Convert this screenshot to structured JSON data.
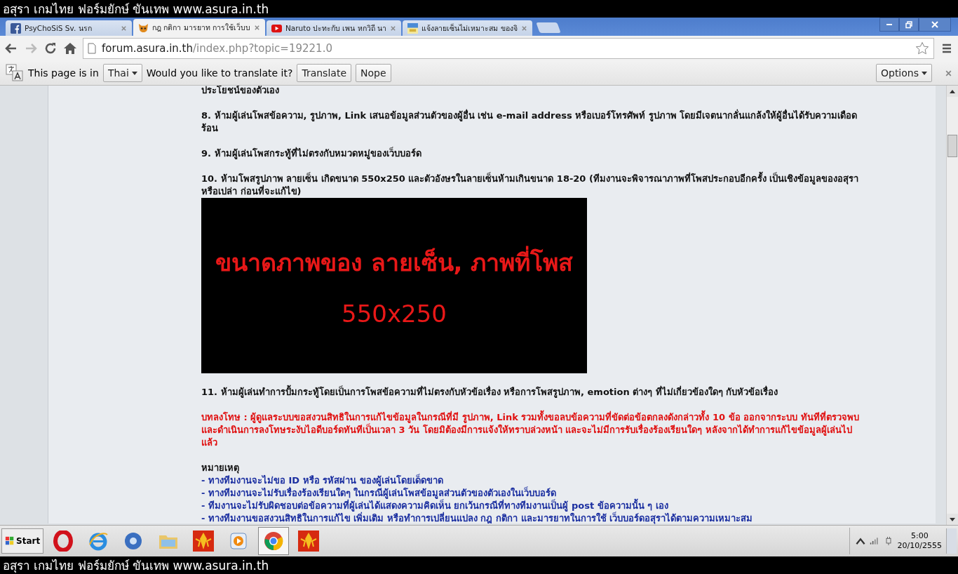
{
  "banner_top": "อสุรา เกมไทย ฟอร์มยักษ์ ขันเทพ www.asura.in.th",
  "tabs": [
    {
      "title": "PsyChoSiS Sv. นรก",
      "selected": false
    },
    {
      "title": "กฎ กติกา มารยาท การใช้เว็บบ",
      "selected": true
    },
    {
      "title": "Naruto ปะทะกับ เพน หกวิถี นา",
      "selected": false
    },
    {
      "title": "แจ้งลายเซ็นไม่เหมาะสม ของจิ",
      "selected": false
    }
  ],
  "address": {
    "host": "forum.asura.in.th",
    "path": "/index.php?topic=19221.0"
  },
  "translate_bar": {
    "prefix": "This page is in",
    "language": "Thai",
    "question": "Would you like to translate it?",
    "translate": "Translate",
    "nope": "Nope",
    "options": "Options"
  },
  "content": [
    {
      "kind": "rule",
      "text": "ประโยชน์ของตัวเอง"
    },
    {
      "kind": "rule",
      "text": "8. ห้ามผู้เล่นโพสข้อความ, รูปภาพ, Link เสนอข้อมูลส่วนตัวของผู้อื่น เช่น e-mail address หรือเบอร์โทรศัพท์ รูปภาพ โดยมีเจตนากลั่นแกล้งให้ผู้อื่นได้รับความเดือดร้อน"
    },
    {
      "kind": "rule",
      "text": "9. ห้ามผู้เล่นโพสกระทู้ที่ไม่ตรงกับหมวดหมู่ของเว็บบอร์ด"
    },
    {
      "kind": "rule",
      "text": "10. ห้ามโพสรูปภาพ ลายเซ็น เกิดขนาด 550x250 และตัวอังษรในลายเซ็นห้ามเกินขนาด 18-20 (ทีมงานจะพิจารณาภาพที่โพสประกอบอีกครั้ง เป็นเชิงข้อมูลของอสุราหรือเปล่า ก่อนที่จะแก้ไข)"
    },
    {
      "kind": "image",
      "caption": "ขนาดภาพของ ลายเซ็น, ภาพที่โพส",
      "size": "550x250"
    },
    {
      "kind": "rule",
      "text": "11. ห้ามผู้เล่นทำการปั้มกระทู้โดยเป็นการโพสข้อความที่ไม่ตรงกับหัวข้อเรื่อง หรือการโพสรูปภาพ, emotion ต่างๆ ที่ไม่เกี่ยวข้องใดๆ กับหัวข้อเรื่อง"
    },
    {
      "kind": "penalty",
      "text": "บทลงโทษ : ผู้ดูแลระบบขอสงวนสิทธิในการแก้ไขข้อมูลในกรณีที่มี รูปภาพ, Link รวมทั้งขอลบข้อความที่ขัดต่อข้อตกลงดังกล่าวทั้ง 10 ข้อ ออกจากระบบ ทันทีที่ตรวจพบ และดำเนินการลงโทษระงับไอดีบอร์ดทันทีเป็นเวลา 3 วัน โดยมิต้องมีการแจ้งให้ทราบล่วงหน้า และจะไม่มีการรับเรื่องร้องเรียนใดๆ หลังจากได้ทำการแก้ไขข้อมูลผู้เล่นไปแล้ว"
    },
    {
      "kind": "heading",
      "text": "หมายเหตุ"
    },
    {
      "kind": "note",
      "text": "- ทางทีมงานจะไม่ขอ ID หรือ รหัสผ่าน ของผู้เล่นโดยเด็ดขาด"
    },
    {
      "kind": "note",
      "text": "- ทางทีมงานจะไม่รับเรื่องร้องเรียนใดๆ ในกรณีผู้เล่นโพสข้อมูลส่วนตัวของตัวเองในเว็บบอร์ด"
    },
    {
      "kind": "note",
      "text": "- ทีมงานจะไม่รับผิดชอบต่อข้อความที่ผู้เล่นได้แสดงความคิดเห็น ยกเว้นกรณีที่ทางทีมงานเป็นผู้ post ข้อความนั้น ๆ เอง"
    },
    {
      "kind": "note",
      "text": "- ทางทีมงานขอสงวนสิทธิในการแก้ไข เพิ่มเติม หรือทำการเปลี่ยนแปลง กฎ กติกา และมารยาทในการใช้ เว็บบอร์ดอสุราได้ตามความเหมาะสม"
    }
  ],
  "taskbar": {
    "start": "Start",
    "apps": [
      {
        "selected": false
      },
      {
        "selected": false
      },
      {
        "selected": false
      },
      {
        "selected": false
      },
      {
        "selected": false
      },
      {
        "selected": false
      },
      {
        "selected": true
      },
      {
        "selected": false
      }
    ],
    "time": "5:00",
    "date": "20/10/2555"
  },
  "banner_bottom": "อสุรา เกมไทย ฟอร์มยักษ์ ขันเทพ www.asura.in.th"
}
